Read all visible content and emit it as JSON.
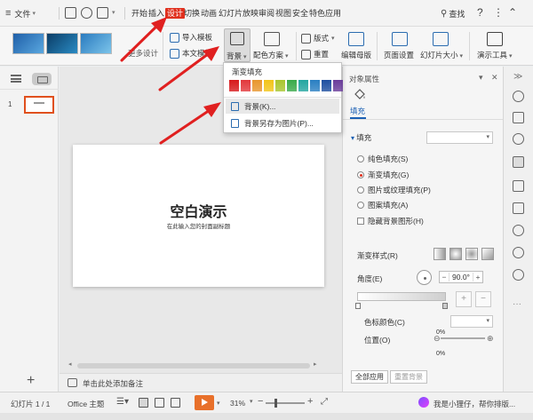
{
  "menubar": {
    "file": "文件",
    "tabs": [
      "开始",
      "插入",
      "设计",
      "切换",
      "动画",
      "幻灯片放映",
      "审阅",
      "视图",
      "安全",
      "特色应用"
    ],
    "active_tab": "设计",
    "search": "查找"
  },
  "ribbon": {
    "more_designs": "更多设计",
    "import_template": "导入模板",
    "text_template": "本文模板",
    "background": "背景",
    "color_scheme": "配色方案",
    "layout": "版式",
    "reset": "重置",
    "edit_master": "编辑母版",
    "page_setup": "页面设置",
    "slide_size": "幻灯片大小",
    "presentation_tools": "演示工具"
  },
  "dropdown": {
    "gradient_fill": "渐变填充",
    "swatch_colors": [
      "#d7191c",
      "#e2383c",
      "#e8962e",
      "#f2c418",
      "#a8c52e",
      "#3aaa4a",
      "#23a6a0",
      "#2a7fc2",
      "#1e4fa0",
      "#6a3d9a"
    ],
    "background_item": "背景(K)...",
    "save_as_image": "背景另存为图片(P)..."
  },
  "slide_panel": {
    "slide_number": "1"
  },
  "slide": {
    "title": "空白演示",
    "subtitle": "在此输入您的封面副标题"
  },
  "notes": {
    "placeholder": "单击此处添加备注"
  },
  "property_pane": {
    "title": "对象属性",
    "tab_fill": "填充",
    "section_fill": "填充",
    "options": {
      "solid": "纯色填充(S)",
      "gradient": "渐变填充(G)",
      "picture": "图片或纹理填充(P)",
      "pattern": "图案填充(A)",
      "hide_bg": "隐藏背景图形(H)"
    },
    "gradient_style": "渐变样式(R)",
    "angle": "角度(E)",
    "angle_value": "90.0°",
    "stop_color": "色标颜色(C)",
    "position": "位置(O)",
    "position_value": "0%",
    "position_value_2": "0%",
    "apply_all": "全部应用",
    "reset_bg": "重置背景"
  },
  "statusbar": {
    "slide_count": "幻灯片 1 / 1",
    "theme": "Office 主题",
    "zoom": "31%",
    "assistant": "我是小狸仔，帮你排版..."
  },
  "colors": {
    "accent_red": "#e0301e",
    "link_blue": "#1a5fb4",
    "arrow_red": "#e02020"
  }
}
